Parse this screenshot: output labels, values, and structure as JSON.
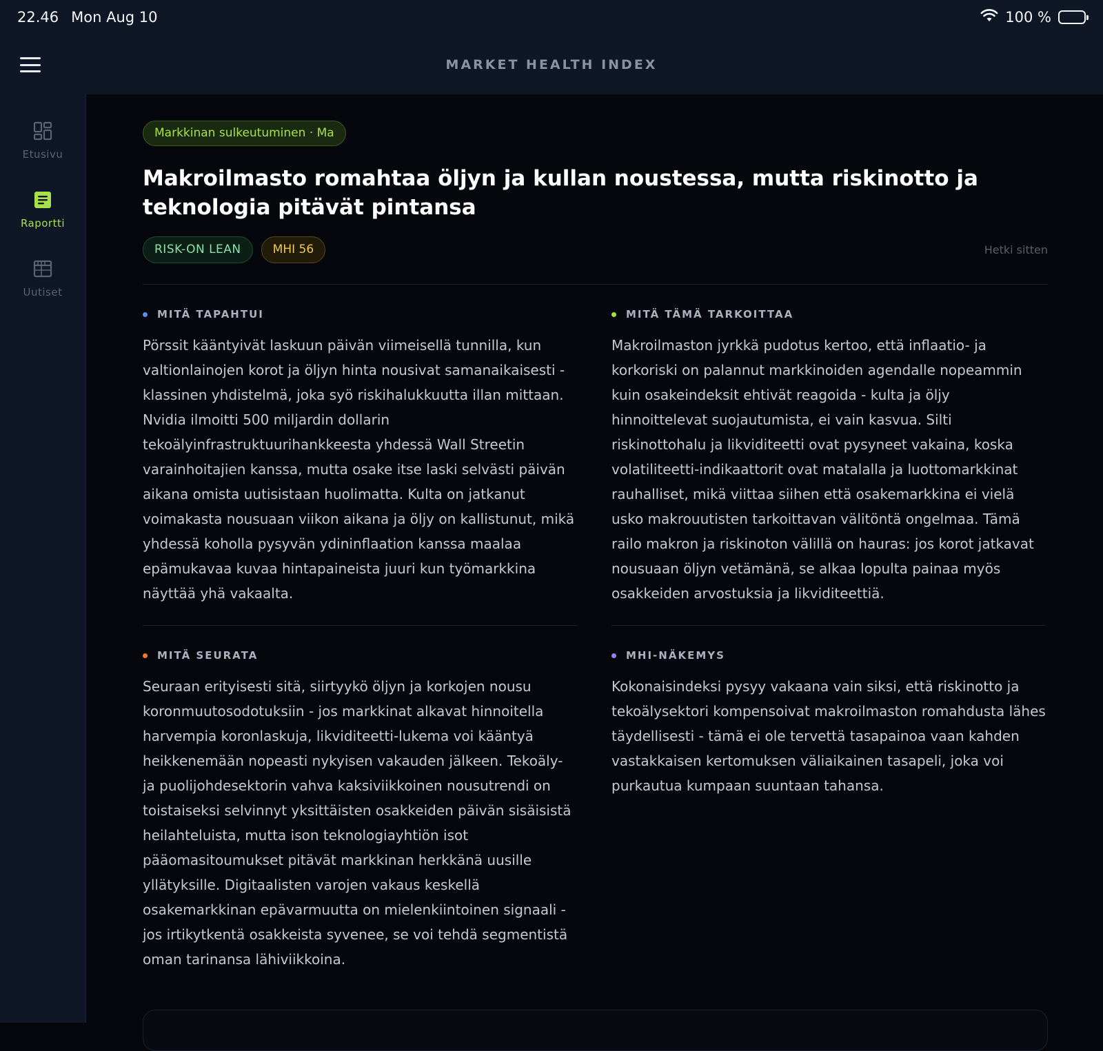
{
  "status": {
    "time": "22.46",
    "date": "Mon Aug 10",
    "battery": "100 %"
  },
  "app": {
    "title": "MARKET HEALTH INDEX"
  },
  "sidebar": {
    "items": [
      {
        "label": "Etusivu",
        "icon": "dashboard-icon",
        "active": false
      },
      {
        "label": "Raportti",
        "icon": "report-icon",
        "active": true
      },
      {
        "label": "Uutiset",
        "icon": "news-icon",
        "active": false
      }
    ]
  },
  "report": {
    "session": "Markkinan sulkeutuminen · Ma",
    "headline": "Makroilmasto romahtaa öljyn ja kullan noustessa, mutta riskinotto ja teknologia pitävät pintansa",
    "stance": "RISK-ON LEAN",
    "mhi": "MHI 56",
    "timestamp": "Hetki sitten",
    "sections": {
      "what_happened": {
        "title": "MITÄ TAPAHTUI",
        "color": "#5b8def",
        "body": "Pörssit kääntyivät laskuun päivän viimeisellä tunnilla, kun valtionlainojen korot ja öljyn hinta nousivat samanaikaisesti - klassinen yhdistelmä, joka syö riskihalukkuutta illan mittaan. Nvidia ilmoitti 500 miljardin dollarin tekoälyinfrastruktuurihankkeesta yhdessä Wall Streetin varainhoitajien kanssa, mutta osake itse laski selvästi päivän aikana omista uutisistaan huolimatta. Kulta on jatkanut voimakasta nousuaan viikon aikana ja öljy on kallistunut, mikä yhdessä koholla pysyvän ydininflaation kanssa maalaa epämukavaa kuvaa hintapaineista juuri kun työmarkkina näyttää yhä vakaalta."
      },
      "what_it_means": {
        "title": "MITÄ TÄMÄ TARKOITTAA",
        "color": "#a8e04a",
        "body": "Makroilmaston jyrkkä pudotus kertoo, että inflaatio- ja korkoriski on palannut markkinoiden agendalle nopeammin kuin osakeindeksit ehtivät reagoida - kulta ja öljy hinnoittelevat suojautumista, ei vain kasvua. Silti riskinottohalu ja likviditeetti ovat pysyneet vakaina, koska volatiliteetti-indikaattorit ovat matalalla ja luottomarkkinat rauhalliset, mikä viittaa siihen että osakemarkkina ei vielä usko makrouutisten tarkoittavan välitöntä ongelmaa. Tämä railo makron ja riskinoton välillä on hauras: jos korot jatkavat nousuaan öljyn vetämänä, se alkaa lopulta painaa myös osakkeiden arvostuksia ja likviditeettiä."
      },
      "what_to_watch": {
        "title": "MITÄ SEURATA",
        "color": "#f07a2a",
        "body": "Seuraan erityisesti sitä, siirtyykö öljyn ja korkojen nousu koronmuutosodotuksiin - jos markkinat alkavat hinnoitella harvempia koronlaskuja, likviditeetti-lukema voi kääntyä heikkenemään nopeasti nykyisen vakauden jälkeen. Tekoäly- ja puolijohdesektorin vahva kaksiviikkoinen nousutrendi on toistaiseksi selvinnyt yksittäisten osakkeiden päivän sisäisistä heilahteluista, mutta ison teknologiayhtiön isot pääomasitoumukset pitävät markkinan herkkänä uusille yllätyksille. Digitaalisten varojen vakaus keskellä osakemarkkinan epävarmuutta on mielenkiintoinen signaali - jos irtikytkentä osakkeista syvenee, se voi tehdä segmentistä oman tarinansa lähiviikkoina."
      },
      "mhi_view": {
        "title": "MHI-NÄKEMYS",
        "color": "#9b7ff0",
        "body": "Kokonaisindeksi pysyy vakaana vain siksi, että riskinotto ja tekoälysektori kompensoivat makroilmaston romahdusta lähes täydellisesti - tämä ei ole tervettä tasapainoa vaan kahden vastakkaisen kertomuksen väliaikainen tasapeli, joka voi purkautua kumpaan suuntaan tahansa."
      }
    }
  }
}
